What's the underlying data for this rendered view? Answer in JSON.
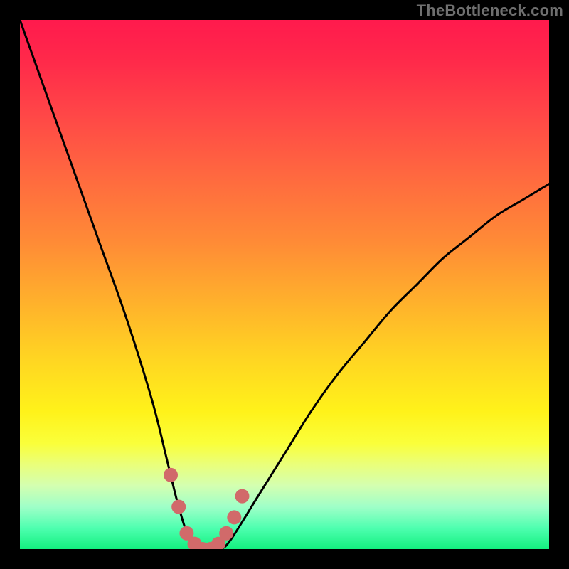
{
  "watermark": "TheBottleneck.com",
  "chart_data": {
    "type": "line",
    "title": "",
    "xlabel": "",
    "ylabel": "",
    "xlim": [
      0,
      100
    ],
    "ylim": [
      0,
      100
    ],
    "series": [
      {
        "name": "bottleneck-curve",
        "x": [
          0,
          5,
          10,
          15,
          20,
          25,
          28,
          30,
          32,
          34,
          36,
          38,
          40,
          45,
          50,
          55,
          60,
          65,
          70,
          75,
          80,
          85,
          90,
          95,
          100
        ],
        "values": [
          100,
          86,
          72,
          58,
          44,
          28,
          16,
          8,
          2,
          0,
          0,
          0,
          2,
          10,
          18,
          26,
          33,
          39,
          45,
          50,
          55,
          59,
          63,
          66,
          69
        ]
      }
    ],
    "markers": {
      "name": "highlight-dots",
      "x": [
        28.5,
        30,
        31.5,
        33,
        34.5,
        36,
        37.5,
        39,
        40.5,
        42
      ],
      "values": [
        14,
        8,
        3,
        1,
        0,
        0,
        1,
        3,
        6,
        10
      ],
      "color": "#d16a6a",
      "radius_px": 10
    },
    "gradient_stops": [
      {
        "pos": 0.0,
        "color": "#ff1a4d"
      },
      {
        "pos": 0.3,
        "color": "#ff6a3f"
      },
      {
        "pos": 0.64,
        "color": "#ffd522"
      },
      {
        "pos": 0.8,
        "color": "#faff3a"
      },
      {
        "pos": 1.0,
        "color": "#13f07f"
      }
    ]
  }
}
